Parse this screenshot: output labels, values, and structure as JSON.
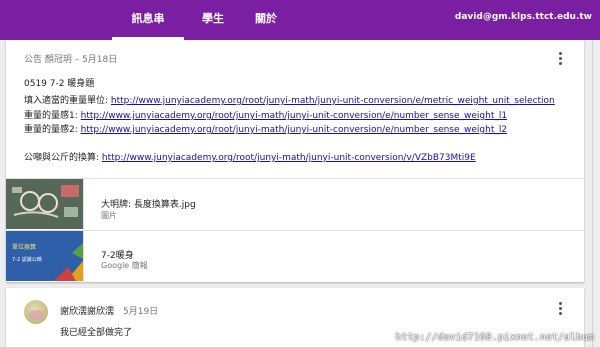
{
  "nav": {
    "tabs": [
      {
        "label": "訊息串",
        "active": true
      },
      {
        "label": "學生",
        "active": false
      },
      {
        "label": "關於",
        "active": false
      }
    ],
    "user_email": "david@gm.klps.ttct.edu.tw",
    "bar_color": "#7b1fa2"
  },
  "post": {
    "meta": "公告   顏冠玥 – 5月18日",
    "title": "0519 7-2 暖身題",
    "lines": [
      {
        "label": "填入適當的重量單位:",
        "url": "http://www.junyiacademy.org/root/junyi-math/junyi-unit-conversion/e/metric_weight_unit_selection"
      },
      {
        "label": "重量的量感1:",
        "url": "http://www.junyiacademy.org/root/junyi-math/junyi-unit-conversion/e/number_sense_weight_l1"
      },
      {
        "label": "重量的量感2:",
        "url": "http://www.junyiacademy.org/root/junyi-math/junyi-unit-conversion/e/number_sense_weight_l2"
      },
      {
        "label": "公噸與公斤的換算:",
        "url": "http://www.junyiacademy.org/root/junyi-math/junyi-unit-conversion/v/VZbB73Mti9E"
      }
    ],
    "attachments": [
      {
        "name": "大明牌: 長度換算表.jpg",
        "type": "圖片",
        "thumb_icon": "photo-thumbnail"
      },
      {
        "name": "7-2暖身",
        "type": "Google 簡報",
        "thumb_icon": "slides-thumbnail",
        "thumb_text": "單位換算\n7-2 認識公噸"
      }
    ]
  },
  "comment": {
    "author": "謝欣濡謝欣濡",
    "date": "5月19日",
    "body": "我已經全部做完了"
  },
  "watermark": "http://david7168.pixnet.net/album"
}
